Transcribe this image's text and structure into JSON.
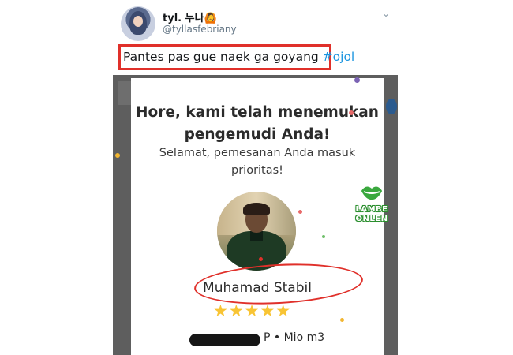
{
  "tweet": {
    "display_name": "tyl. 누나🙆",
    "handle": "@tyllasfebriany",
    "text_prefix": "Pantes pas gue naek ga goyang ",
    "hashtag": "#ojol",
    "caret_icon": "chevron-down-icon"
  },
  "dialog": {
    "title_line1": "Hore, kami telah menemukan",
    "title_line2": "pengemudi Anda!",
    "subtitle_line1": "Selamat, pemesanan Anda masuk",
    "subtitle_line2": "prioritas!",
    "driver_name": "Muhamad Stabil",
    "rating_stars": "★★★★★",
    "rating": 5,
    "vehicle_suffix": "P • Mio m3"
  },
  "watermark": {
    "line1": "LAMBE",
    "line2": "ONLEN"
  },
  "colors": {
    "highlight_border": "#e0302a",
    "hashtag": "#1b95e0",
    "star": "#f8c434",
    "watermark_green": "#2c8f2f"
  }
}
